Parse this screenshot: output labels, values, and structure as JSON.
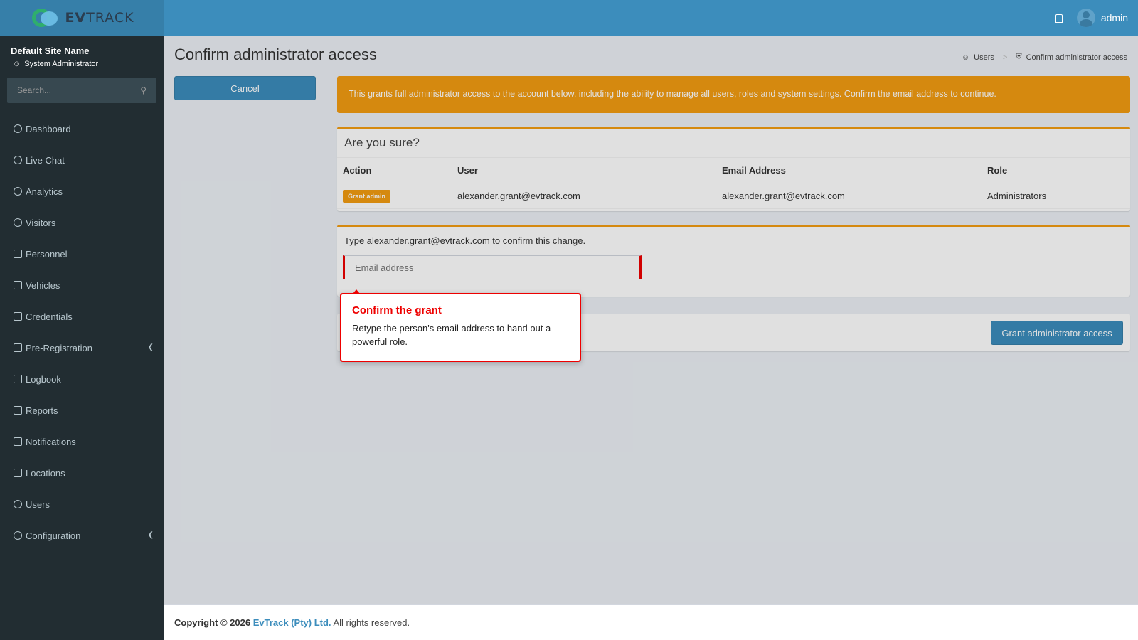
{
  "header": {
    "logo_text_bold": "EV",
    "logo_text": "TRACK",
    "user_name": "admin"
  },
  "sidebar": {
    "site_name": "Default Site Name",
    "role": "System Administrator",
    "search_placeholder": "Search...",
    "items": [
      {
        "label": "Dashboard",
        "icon": "dashboard-icon"
      },
      {
        "label": "Live Chat",
        "icon": "headset-icon"
      },
      {
        "label": "Analytics",
        "icon": "target-icon"
      },
      {
        "label": "Visitors",
        "icon": "eye-icon"
      },
      {
        "label": "Personnel",
        "icon": "user-group-icon"
      },
      {
        "label": "Vehicles",
        "icon": "car-icon"
      },
      {
        "label": "Credentials",
        "icon": "id-card-icon"
      },
      {
        "label": "Pre-Registration",
        "icon": "swap-icon"
      },
      {
        "label": "Logbook",
        "icon": "book-icon"
      },
      {
        "label": "Reports",
        "icon": "chart-icon"
      },
      {
        "label": "Notifications",
        "icon": "message-icon"
      },
      {
        "label": "Locations",
        "icon": "map-icon"
      },
      {
        "label": "Users",
        "icon": "users-icon"
      },
      {
        "label": "Configuration",
        "icon": "gear-icon"
      }
    ]
  },
  "page": {
    "title": "Confirm administrator access",
    "breadcrumb": [
      "Users",
      "Confirm administrator access"
    ],
    "cancel_label": "Cancel",
    "warning": "This grants full administrator access to the account below, including the ability to manage all users, roles and system settings. Confirm the email address to continue.",
    "box_title": "Are you sure?",
    "table": {
      "headers": [
        "Action",
        "User",
        "Email Address",
        "Role"
      ],
      "row": {
        "action": "Grant admin",
        "user": "alexander.grant@evtrack.com",
        "email": "alexander.grant@evtrack.com",
        "role": "Administrators"
      }
    },
    "confirm_text": "Type alexander.grant@evtrack.com to confirm this change.",
    "email_placeholder": "Email address",
    "grant_label": "Grant administrator access"
  },
  "tooltip": {
    "title": "Confirm the grant",
    "body": "Retype the person's email address to hand out a powerful role."
  },
  "footer": {
    "prefix": "Copyright © 2026",
    "company": "EvTrack (Pty) Ltd.",
    "suffix": "All rights reserved."
  },
  "colors": {
    "primary": "#3c8dbc",
    "warning": "#f39c12",
    "sidebar": "#222d32",
    "highlight": "#e00000"
  }
}
